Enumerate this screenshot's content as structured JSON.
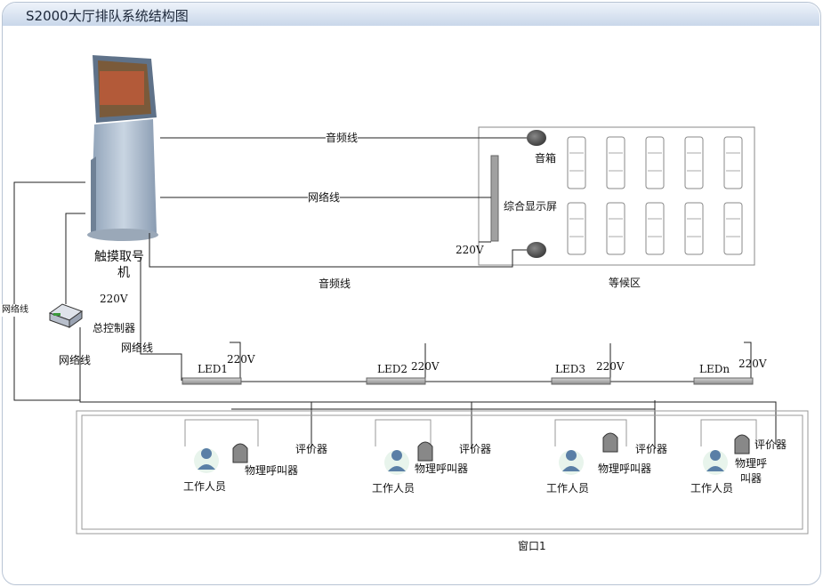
{
  "title": "S2000大厅排队系统结构图",
  "kiosk": {
    "label_line1": "触摸取号",
    "label_line2": "机"
  },
  "controller": {
    "label": "总控制器",
    "power": "220V"
  },
  "lines": {
    "audio_top": "音频线",
    "network_mid": "网络线",
    "audio_bottom": "音频线",
    "network_left": "网络线",
    "network_ctrl": "网络线",
    "network_led": "网络线"
  },
  "waiting_area": {
    "label": "等候区",
    "speaker_label": "音箱",
    "display_label": "综合显示屏",
    "power": "220V"
  },
  "leds": [
    {
      "label": "LED1",
      "power": "220V"
    },
    {
      "label": "LED2",
      "power": "220V"
    },
    {
      "label": "LED3",
      "power": "220V"
    },
    {
      "label": "LEDn",
      "power": "220V"
    }
  ],
  "windows": [
    {
      "worker": "工作人员",
      "caller": "物理呼叫器",
      "evaluator": "评价器"
    },
    {
      "worker": "工作人员",
      "caller": "物理呼叫器",
      "evaluator": "评价器"
    },
    {
      "worker": "工作人员",
      "caller": "物理呼叫器",
      "evaluator": "评价器"
    },
    {
      "worker": "工作人员",
      "caller_line1": "物理呼",
      "caller_line2": "叫器",
      "evaluator": "评价器"
    }
  ],
  "window_area": {
    "label": "窗口1"
  },
  "colors": {
    "header_bg": "#c9d7ea",
    "led_bar": "#a8a8a8",
    "kiosk_body": "#b9c6d6",
    "worker_icon": "#5a7fa6"
  }
}
